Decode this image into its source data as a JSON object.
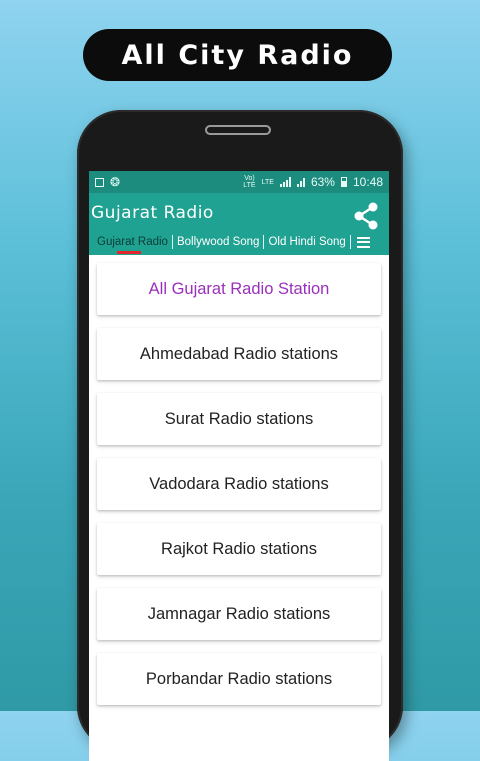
{
  "banner": {
    "title": "All City Radio"
  },
  "status_bar": {
    "lte_top": "Vo)",
    "lte_bottom": "LTE",
    "lte2": "LTE",
    "battery_pct": "63%",
    "time": "10:48"
  },
  "app_bar": {
    "title": "Gujarat Radio"
  },
  "tabs": [
    {
      "label": "Gujarat Radio"
    },
    {
      "label": "Bollywood Song"
    },
    {
      "label": "Old Hindi Song"
    }
  ],
  "stations": [
    {
      "label": "All Gujarat Radio Station"
    },
    {
      "label": "Ahmedabad Radio stations"
    },
    {
      "label": "Surat Radio stations"
    },
    {
      "label": "Vadodara Radio stations"
    },
    {
      "label": "Rajkot Radio stations"
    },
    {
      "label": "Jamnagar Radio stations"
    },
    {
      "label": "Porbandar Radio stations"
    }
  ],
  "colors": {
    "status": "#1b8c7e",
    "appbar": "#1fa292",
    "highlight": "#9a2fbb",
    "tab_indicator": "#e3262e"
  }
}
